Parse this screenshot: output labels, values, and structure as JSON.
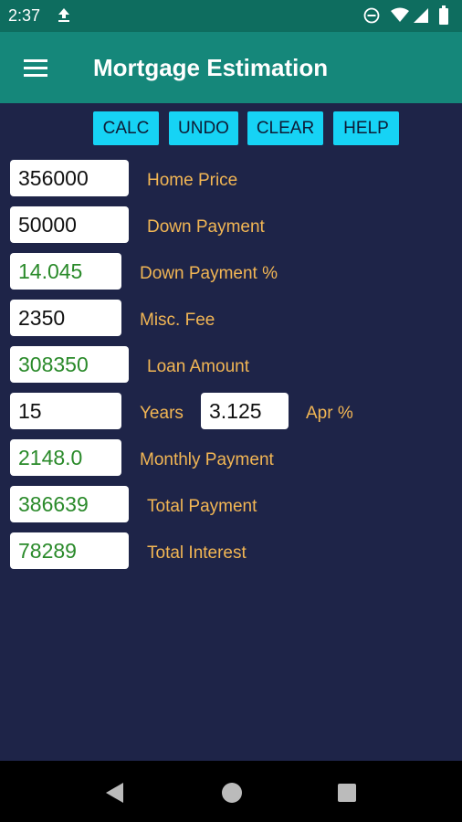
{
  "status_bar": {
    "time": "2:37"
  },
  "app_bar": {
    "title": "Mortgage Estimation"
  },
  "toolbar": {
    "calc": "CALC",
    "undo": "UNDO",
    "clear": "CLEAR",
    "help": "HELP"
  },
  "form": {
    "home_price": {
      "value": "356000",
      "label": "Home Price"
    },
    "down_payment": {
      "value": "50000",
      "label": "Down Payment"
    },
    "down_payment_pct": {
      "value": "14.045",
      "label": "Down Payment %"
    },
    "misc_fee": {
      "value": "2350",
      "label": "Misc. Fee"
    },
    "loan_amount": {
      "value": "308350",
      "label": "Loan Amount"
    },
    "years": {
      "value": "15",
      "label": "Years"
    },
    "apr": {
      "value": "3.125",
      "label": "Apr %"
    },
    "monthly_payment": {
      "value": "2148.0",
      "label": "Monthly Payment"
    },
    "total_payment": {
      "value": "386639",
      "label": "Total Payment"
    },
    "total_interest": {
      "value": "78289",
      "label": "Total Interest"
    }
  },
  "colors": {
    "background": "#1e2448",
    "app_bar": "#15877a",
    "status_bar": "#0e6d5f",
    "button": "#16d3f5",
    "label": "#f2b654",
    "calculated_text": "#2a8a2a"
  },
  "icons": {
    "upload": "upload-icon",
    "dnd": "do-not-disturb-icon",
    "wifi": "wifi-icon",
    "signal": "signal-icon",
    "battery": "battery-icon",
    "menu": "hamburger-menu-icon",
    "back": "back-triangle-icon",
    "home": "home-circle-icon",
    "recents": "recents-square-icon"
  }
}
